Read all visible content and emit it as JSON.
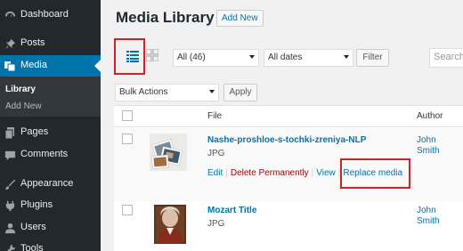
{
  "sidebar": {
    "items": [
      {
        "label": "Dashboard",
        "icon": "dashboard-icon"
      },
      {
        "label": "Posts",
        "icon": "pin-icon"
      },
      {
        "label": "Media",
        "icon": "media-icon"
      },
      {
        "label": "Pages",
        "icon": "pages-icon"
      },
      {
        "label": "Comments",
        "icon": "comments-icon"
      },
      {
        "label": "Appearance",
        "icon": "appearance-icon"
      },
      {
        "label": "Plugins",
        "icon": "plugins-icon"
      },
      {
        "label": "Users",
        "icon": "users-icon"
      },
      {
        "label": "Tools",
        "icon": "tools-icon"
      }
    ],
    "submenu": [
      "Library",
      "Add New"
    ],
    "active_item": "Media",
    "current_submenu": "Library"
  },
  "header": {
    "title": "Media Library",
    "add_new_label": "Add New"
  },
  "filters": {
    "mode": "list",
    "type_filter": "All (46)",
    "date_filter": "All dates",
    "filter_button": "Filter",
    "search_placeholder": "Search"
  },
  "bulk": {
    "bulk_actions": "Bulk Actions",
    "apply_label": "Apply"
  },
  "table": {
    "columns": [
      "File",
      "Author"
    ],
    "rows": [
      {
        "title": "Nashe-proshloe-s-tochki-zreniya-NLP",
        "mime": "JPG",
        "author_first": "John",
        "author_last": "Smith",
        "actions": [
          "Edit",
          "Delete Permanently",
          "View",
          "Replace media"
        ]
      },
      {
        "title": "Mozart Title",
        "mime": "JPG",
        "author_first": "John",
        "author_last": "Smith"
      }
    ]
  },
  "colors": {
    "sidebar_bg": "#23282d",
    "active_bg": "#0073aa",
    "link": "#0073aa",
    "delete": "#aa0000",
    "highlight": "#d32027"
  }
}
